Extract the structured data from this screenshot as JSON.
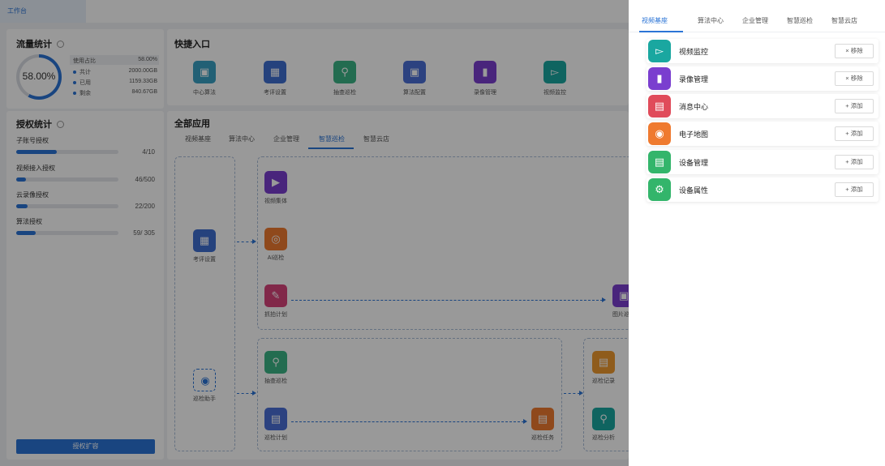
{
  "topbar": {
    "tab_label": "工作台"
  },
  "traffic": {
    "title": "流量统计",
    "percent": "58.00%",
    "ratio": 0.58,
    "head_label": "使用占比",
    "head_value": "58.00%",
    "rows": [
      {
        "label": "共计",
        "value": "2000.00GB"
      },
      {
        "label": "已用",
        "value": "1159.33GB"
      },
      {
        "label": "剩余",
        "value": "840.67GB"
      }
    ]
  },
  "auth": {
    "title": "授权统计",
    "items": [
      {
        "label": "子账号授权",
        "value": "4/10",
        "ratio": 0.4
      },
      {
        "label": "视频接入授权",
        "value": "46/500",
        "ratio": 0.092
      },
      {
        "label": "云录像授权",
        "value": "22/200",
        "ratio": 0.11
      },
      {
        "label": "算法授权",
        "value": "59/ 305",
        "ratio": 0.193
      }
    ],
    "apply_label": "授权扩容"
  },
  "quick": {
    "title": "快捷入口",
    "items": [
      {
        "label": "中心算法",
        "color": "#3aa1c4",
        "icon": "cube-icon"
      },
      {
        "label": "考评设置",
        "color": "#3f6fd1",
        "icon": "grid-icon"
      },
      {
        "label": "抽查巡检",
        "color": "#3bb586",
        "icon": "scan-icon"
      },
      {
        "label": "算法配置",
        "color": "#4a6fd6",
        "icon": "cube-icon"
      },
      {
        "label": "录像管理",
        "color": "#7a3ecf",
        "icon": "record-icon"
      },
      {
        "label": "视频监控",
        "color": "#1aa7a0",
        "icon": "camera-icon"
      }
    ]
  },
  "apps": {
    "title": "全部应用",
    "tabs": [
      "视频基座",
      "算法中心",
      "企业管理",
      "智慧巡检",
      "智慧云店"
    ],
    "active_tab": 3,
    "flow": {
      "n1": "考评设置",
      "n2": "视频集体",
      "n3": "AI巡检",
      "n4": "抓拍计划",
      "n5": "图片巡",
      "n6": "巡检助手",
      "n7": "抽查巡检",
      "n8": "巡检计划",
      "n9": "巡检任务",
      "n10": "巡检记录",
      "n11": "巡检分析"
    }
  },
  "drawer": {
    "tabs": [
      "视频基座",
      "算法中心",
      "企业管理",
      "智慧巡检",
      "智慧云店"
    ],
    "active_tab": 0,
    "items": [
      {
        "name": "视频监控",
        "action": "× 移除",
        "color": "#1aa7a0",
        "icon": "camera-icon"
      },
      {
        "name": "录像管理",
        "action": "× 移除",
        "color": "#7a3ecf",
        "icon": "record-icon"
      },
      {
        "name": "消息中心",
        "action": "+ 添加",
        "color": "#e04b5a",
        "icon": "message-icon"
      },
      {
        "name": "电子地图",
        "action": "+ 添加",
        "color": "#ef7a2f",
        "icon": "map-pin-icon"
      },
      {
        "name": "设备管理",
        "action": "+ 添加",
        "color": "#33b56b",
        "icon": "device-icon"
      },
      {
        "name": "设备属性",
        "action": "+ 添加",
        "color": "#33b56b",
        "icon": "device-settings-icon"
      }
    ]
  }
}
